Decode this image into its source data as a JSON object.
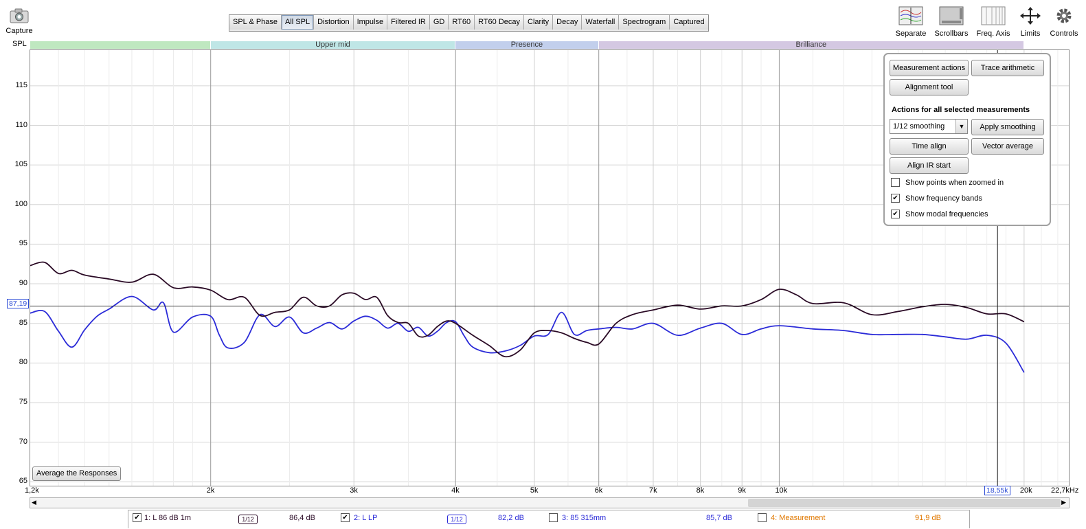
{
  "capture": {
    "label": "Capture"
  },
  "tabs": [
    "SPL & Phase",
    "All SPL",
    "Distortion",
    "Impulse",
    "Filtered IR",
    "GD",
    "RT60",
    "RT60 Decay",
    "Clarity",
    "Decay",
    "Waterfall",
    "Spectrogram",
    "Captured"
  ],
  "active_tab": "All SPL",
  "tools": [
    {
      "label": "Separate",
      "icon": "separate-icon"
    },
    {
      "label": "Scrollbars",
      "icon": "scrollbars-icon"
    },
    {
      "label": "Freq. Axis",
      "icon": "freq-axis-icon"
    },
    {
      "label": "Limits",
      "icon": "limits-icon"
    },
    {
      "label": "Controls",
      "icon": "gear-icon"
    }
  ],
  "bands": [
    {
      "label": "",
      "color": "#bfe8c0"
    },
    {
      "label": "Upper mid",
      "color": "#bfe6e6"
    },
    {
      "label": "Presence",
      "color": "#c2cfec"
    },
    {
      "label": "Brilliance",
      "color": "#d4c8e2"
    }
  ],
  "panel": {
    "measurement_actions": "Measurement actions",
    "trace_arithmetic": "Trace arithmetic",
    "alignment_tool": "Alignment tool",
    "heading": "Actions for all selected measurements",
    "smoothing_value": "1/12 smoothing",
    "apply_smoothing": "Apply smoothing",
    "time_align": "Time align",
    "vector_average": "Vector average",
    "align_ir_start": "Align IR start",
    "checks": [
      {
        "label": "Show points when zoomed in",
        "checked": false
      },
      {
        "label": "Show frequency bands",
        "checked": true
      },
      {
        "label": "Show modal frequencies",
        "checked": true
      }
    ]
  },
  "average_button": "Average the Responses",
  "cursor": {
    "y": "87,19",
    "x": "18,55k"
  },
  "legend": [
    {
      "label": "1: L 86 dB 1m",
      "smoothing": "1/12",
      "value": "86,4 dB",
      "checked": true,
      "color": "#2a0a25"
    },
    {
      "label": "2: L LP",
      "smoothing": "1/12",
      "value": "82,2 dB",
      "checked": true,
      "color": "#2b2bd8"
    },
    {
      "label": "3: 85 315mm",
      "value": "85,7 dB",
      "checked": false,
      "color": "#2b2bd8"
    },
    {
      "label": "4: Measurement",
      "value": "91,9 dB",
      "checked": false,
      "color": "#e07800"
    }
  ],
  "chart_data": {
    "type": "line",
    "ylabel": "SPL",
    "xlabel": "",
    "x_unit": "kHz",
    "y_ticks": [
      65,
      70,
      75,
      80,
      85,
      90,
      95,
      100,
      105,
      110,
      115
    ],
    "x_ticks": [
      "1,2k",
      "2k",
      "3k",
      "4k",
      "5k",
      "6k",
      "7k",
      "8k",
      "9k",
      "10k",
      "20k",
      "22,7kHz"
    ],
    "xlim": [
      1200,
      22700
    ],
    "ylim": [
      64.5,
      119.5
    ],
    "x_scale": "log",
    "cursor_hline": 87.19,
    "cursor_vline": 18550,
    "series": [
      {
        "name": "1: L 86 dB 1m",
        "color": "#2a0a25",
        "x": [
          1200,
          1250,
          1300,
          1350,
          1400,
          1500,
          1600,
          1700,
          1800,
          1900,
          2000,
          2100,
          2200,
          2300,
          2400,
          2500,
          2600,
          2700,
          2800,
          2900,
          3000,
          3100,
          3200,
          3300,
          3400,
          3500,
          3600,
          3700,
          3800,
          3900,
          4000,
          4200,
          4400,
          4600,
          4800,
          5000,
          5200,
          5400,
          5600,
          5800,
          6000,
          6300,
          6600,
          7000,
          7500,
          8000,
          8500,
          9000,
          9500,
          10000,
          10500,
          11000,
          12000,
          13000,
          14000,
          15000,
          16000,
          17000,
          18000,
          19000,
          20000
        ],
        "y": [
          92.3,
          92.7,
          91.3,
          91.7,
          91.1,
          90.6,
          90.2,
          91.2,
          89.5,
          89.6,
          89.2,
          88.0,
          88.3,
          86.0,
          86.4,
          86.7,
          88.3,
          87.2,
          87.2,
          88.6,
          88.8,
          88.0,
          88.3,
          86.0,
          85.1,
          85.0,
          83.4,
          83.5,
          84.6,
          85.3,
          85.0,
          83.5,
          82.2,
          80.8,
          81.6,
          83.8,
          84.1,
          83.8,
          83.1,
          82.6,
          82.4,
          85.0,
          86.1,
          86.7,
          87.3,
          86.8,
          87.2,
          87.2,
          88.0,
          89.3,
          88.6,
          87.5,
          87.6,
          86.1,
          86.5,
          87.1,
          87.4,
          87.0,
          86.2,
          86.2,
          85.2
        ]
      },
      {
        "name": "2: L LP",
        "color": "#2b2bd8",
        "x": [
          1200,
          1250,
          1300,
          1350,
          1400,
          1450,
          1500,
          1600,
          1700,
          1750,
          1800,
          1900,
          2000,
          2050,
          2100,
          2200,
          2300,
          2400,
          2500,
          2600,
          2700,
          2800,
          2900,
          3000,
          3100,
          3200,
          3300,
          3400,
          3500,
          3600,
          3700,
          3800,
          3900,
          4000,
          4100,
          4200,
          4400,
          4600,
          4800,
          5000,
          5200,
          5400,
          5600,
          5800,
          6000,
          6300,
          6600,
          7000,
          7500,
          8000,
          8500,
          9000,
          9500,
          10000,
          11000,
          12000,
          13000,
          14000,
          15000,
          16000,
          17000,
          18000,
          19000,
          20000
        ],
        "y": [
          86.3,
          86.5,
          84.0,
          82.0,
          84.2,
          85.9,
          86.8,
          88.4,
          86.7,
          87.6,
          83.9,
          85.8,
          85.9,
          83.5,
          81.9,
          82.6,
          86.1,
          84.6,
          85.8,
          83.8,
          84.4,
          85.1,
          84.3,
          85.3,
          85.9,
          85.4,
          84.4,
          85.0,
          84.0,
          84.5,
          83.4,
          84.0,
          85.1,
          85.2,
          83.4,
          82.0,
          81.3,
          81.5,
          82.2,
          83.4,
          83.6,
          86.4,
          83.6,
          84.1,
          84.3,
          84.5,
          84.3,
          85.0,
          83.5,
          84.4,
          85.0,
          83.6,
          84.3,
          84.7,
          84.3,
          84.1,
          83.6,
          83.6,
          83.6,
          83.3,
          83.0,
          83.5,
          82.5,
          78.8
        ]
      }
    ]
  }
}
